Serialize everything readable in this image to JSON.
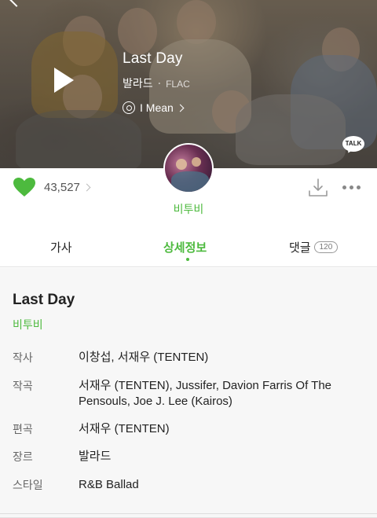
{
  "player": {
    "title": "Last Day",
    "genre": "발라드",
    "separator": "·",
    "format": "FLAC",
    "album": "I Mean",
    "talk_label": "TALK"
  },
  "actions": {
    "like_count": "43,527",
    "artist_name": "비투비"
  },
  "tabs": [
    {
      "label": "가사",
      "active": false
    },
    {
      "label": "상세정보",
      "active": true
    },
    {
      "label": "댓글",
      "badge": "120",
      "active": false
    }
  ],
  "details": {
    "title": "Last Day",
    "artist": "비투비",
    "rows": [
      {
        "label": "작사",
        "value": "이창섭, 서재우 (TENTEN)"
      },
      {
        "label": "작곡",
        "value": "서재우 (TENTEN), Jussifer, Davion Farris Of The Pensouls, Joe J. Lee (Kairos)"
      },
      {
        "label": "편곡",
        "value": "서재우 (TENTEN)"
      },
      {
        "label": "장르",
        "value": "발라드"
      },
      {
        "label": "스타일",
        "value": "R&B Ballad"
      }
    ]
  },
  "colors": {
    "accent": "#4dba3e",
    "heart": "#4dba3e"
  }
}
